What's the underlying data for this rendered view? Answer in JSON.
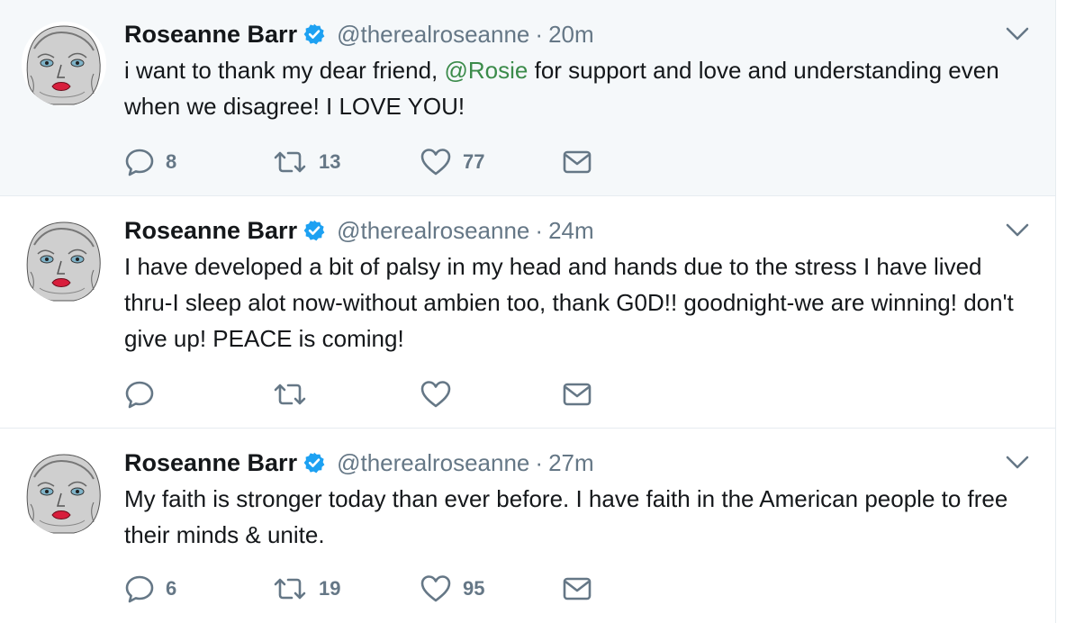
{
  "tweets": [
    {
      "name": "Roseanne Barr",
      "handle": "@therealroseanne",
      "separator": "·",
      "time": "20m",
      "text_before": "i want to thank my dear friend, ",
      "mention": "@Rosie",
      "text_after": " for support and love and understanding even when we disagree! I LOVE YOU!",
      "replies": "8",
      "retweets": "13",
      "likes": "77"
    },
    {
      "name": "Roseanne Barr",
      "handle": "@therealroseanne",
      "separator": "·",
      "time": "24m",
      "text": "I have developed a bit of palsy in my head and hands due to the stress I have lived thru-I sleep alot now-without ambien too, thank G0D!! goodnight-we are winning! don't give up! PEACE is coming!",
      "replies": "",
      "retweets": "",
      "likes": ""
    },
    {
      "name": "Roseanne Barr",
      "handle": "@therealroseanne",
      "separator": "·",
      "time": "27m",
      "text": "My faith is stronger today than ever before. I have faith in the American people to free their minds & unite.",
      "replies": "6",
      "retweets": "19",
      "likes": "95"
    }
  ],
  "icons": {
    "verified": "verified-badge-icon",
    "reply": "reply-icon",
    "retweet": "retweet-icon",
    "like": "heart-icon",
    "dm": "envelope-icon",
    "caret": "chevron-down-icon"
  },
  "colors": {
    "background_highlight": "#f5f8fa",
    "text": "#14171a",
    "secondary": "#657786",
    "mention": "#3b8b4a",
    "verified": "#1da1f2"
  }
}
